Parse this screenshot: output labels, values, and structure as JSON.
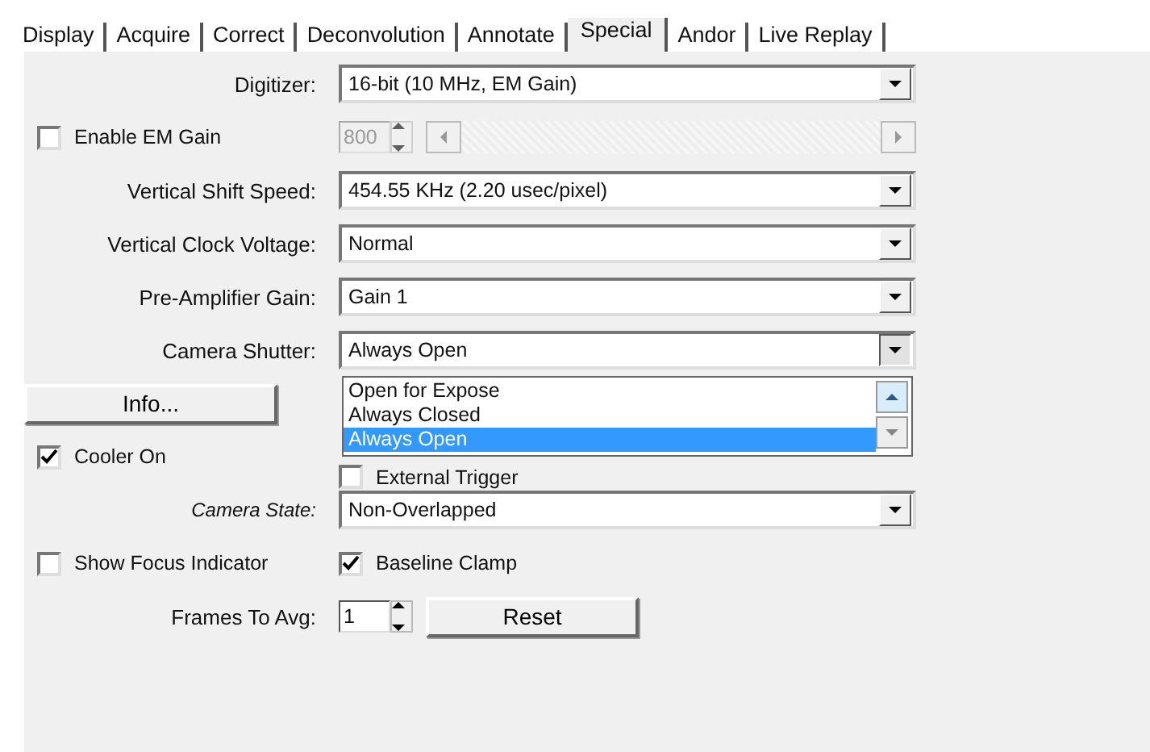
{
  "tabs": [
    {
      "label": "Display",
      "selected": false
    },
    {
      "label": "Acquire",
      "selected": false
    },
    {
      "label": "Correct",
      "selected": false
    },
    {
      "label": "Deconvolution",
      "selected": false
    },
    {
      "label": "Annotate",
      "selected": false
    },
    {
      "label": "Special",
      "selected": true
    },
    {
      "label": "Andor",
      "selected": false
    },
    {
      "label": "Live Replay",
      "selected": false
    }
  ],
  "digitizer": {
    "label": "Digitizer:",
    "value": "16-bit (10 MHz, EM Gain)"
  },
  "em_gain": {
    "label": "Enable EM Gain",
    "checked": false,
    "value": "800",
    "disabled": true
  },
  "vertical_shift_speed": {
    "label": "Vertical Shift Speed:",
    "value": "454.55 KHz (2.20 usec/pixel)"
  },
  "vertical_clock_voltage": {
    "label": "Vertical Clock Voltage:",
    "value": "Normal"
  },
  "pre_amplifier_gain": {
    "label": "Pre-Amplifier Gain:",
    "value": "Gain 1"
  },
  "camera_shutter": {
    "label": "Camera Shutter:",
    "value": "Always Open",
    "expanded": true,
    "options": [
      {
        "label": "Open for Expose",
        "selected": false
      },
      {
        "label": "Always Closed",
        "selected": false
      },
      {
        "label": "Always Open",
        "selected": true
      }
    ]
  },
  "info_button": "Info...",
  "cooler_on": {
    "label": "Cooler On",
    "checked": true
  },
  "external_trigger": {
    "label": "External Trigger",
    "checked": false
  },
  "camera_state": {
    "label": "Camera State:",
    "value": "Non-Overlapped"
  },
  "show_focus_indicator": {
    "label": "Show Focus Indicator",
    "checked": false
  },
  "baseline_clamp": {
    "label": "Baseline Clamp",
    "checked": true
  },
  "frames_to_avg": {
    "label": "Frames To Avg:",
    "value": "1"
  },
  "reset_button": "Reset"
}
